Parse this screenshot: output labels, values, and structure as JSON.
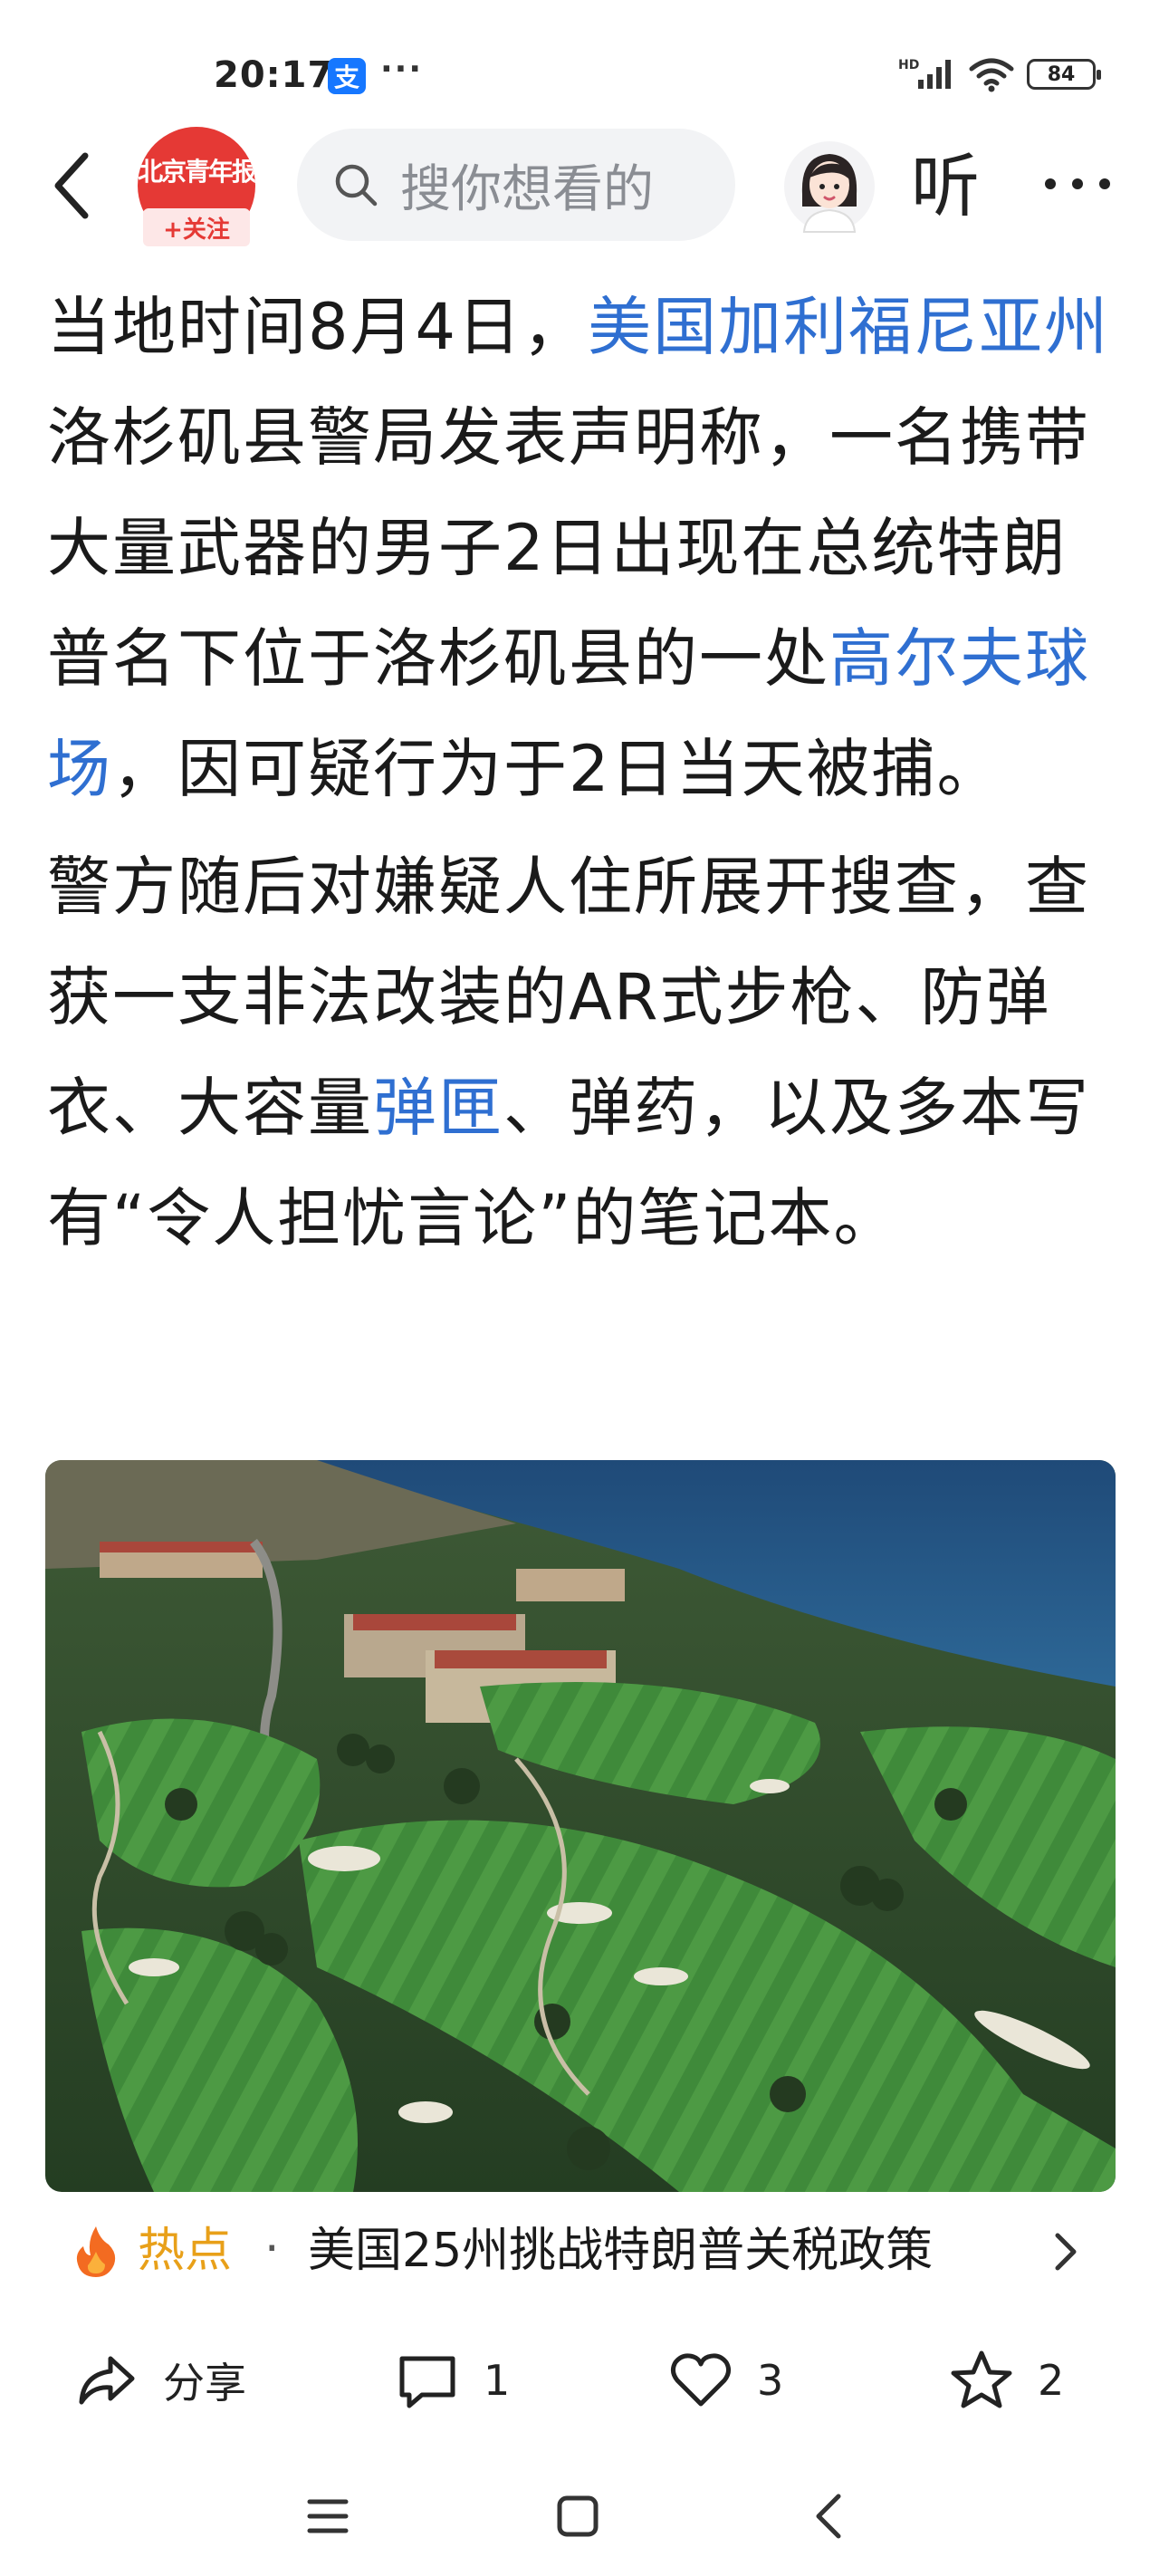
{
  "status_bar": {
    "time": "20:17",
    "app_badge": "支",
    "dots": "···",
    "network": "HD",
    "battery": "84"
  },
  "nav": {
    "avatar_logo": "北京青年报",
    "follow_label": "+关注",
    "search_placeholder": "搜你想看的",
    "listen_label": "听"
  },
  "article": {
    "paragraphs": [
      {
        "parts": [
          {
            "text": "当地时间8月4日，",
            "link": false
          },
          {
            "text": "美国加利福尼亚州",
            "link": true
          },
          {
            "text": "洛杉矶县警局发表声明称，一名携带大量武器的男子2日出现在总统特朗普名下位于洛杉矶县的一处",
            "link": false
          },
          {
            "text": "高尔夫球场",
            "link": true
          },
          {
            "text": "，因可疑行为于2日当天被捕。",
            "link": false
          }
        ]
      },
      {
        "parts": [
          {
            "text": "警方随后对嫌疑人住所展开搜查，查获一支非法改装的AR式步枪、防弹衣、大容量",
            "link": false
          },
          {
            "text": "弹匣",
            "link": true
          },
          {
            "text": "、弹药，以及多本写有“令人担忧言论”的笔记本。",
            "link": false
          }
        ]
      }
    ]
  },
  "hot_topic": {
    "label": "热点",
    "separator": "·",
    "title": "美国25州挑战特朗普关税政策"
  },
  "actions": {
    "share_label": "分享",
    "comment_count": "1",
    "like_count": "3",
    "favorite_count": "2"
  },
  "colors": {
    "link": "#2f6fd1",
    "hot": "#e8a019",
    "brand_red": "#e53935"
  }
}
